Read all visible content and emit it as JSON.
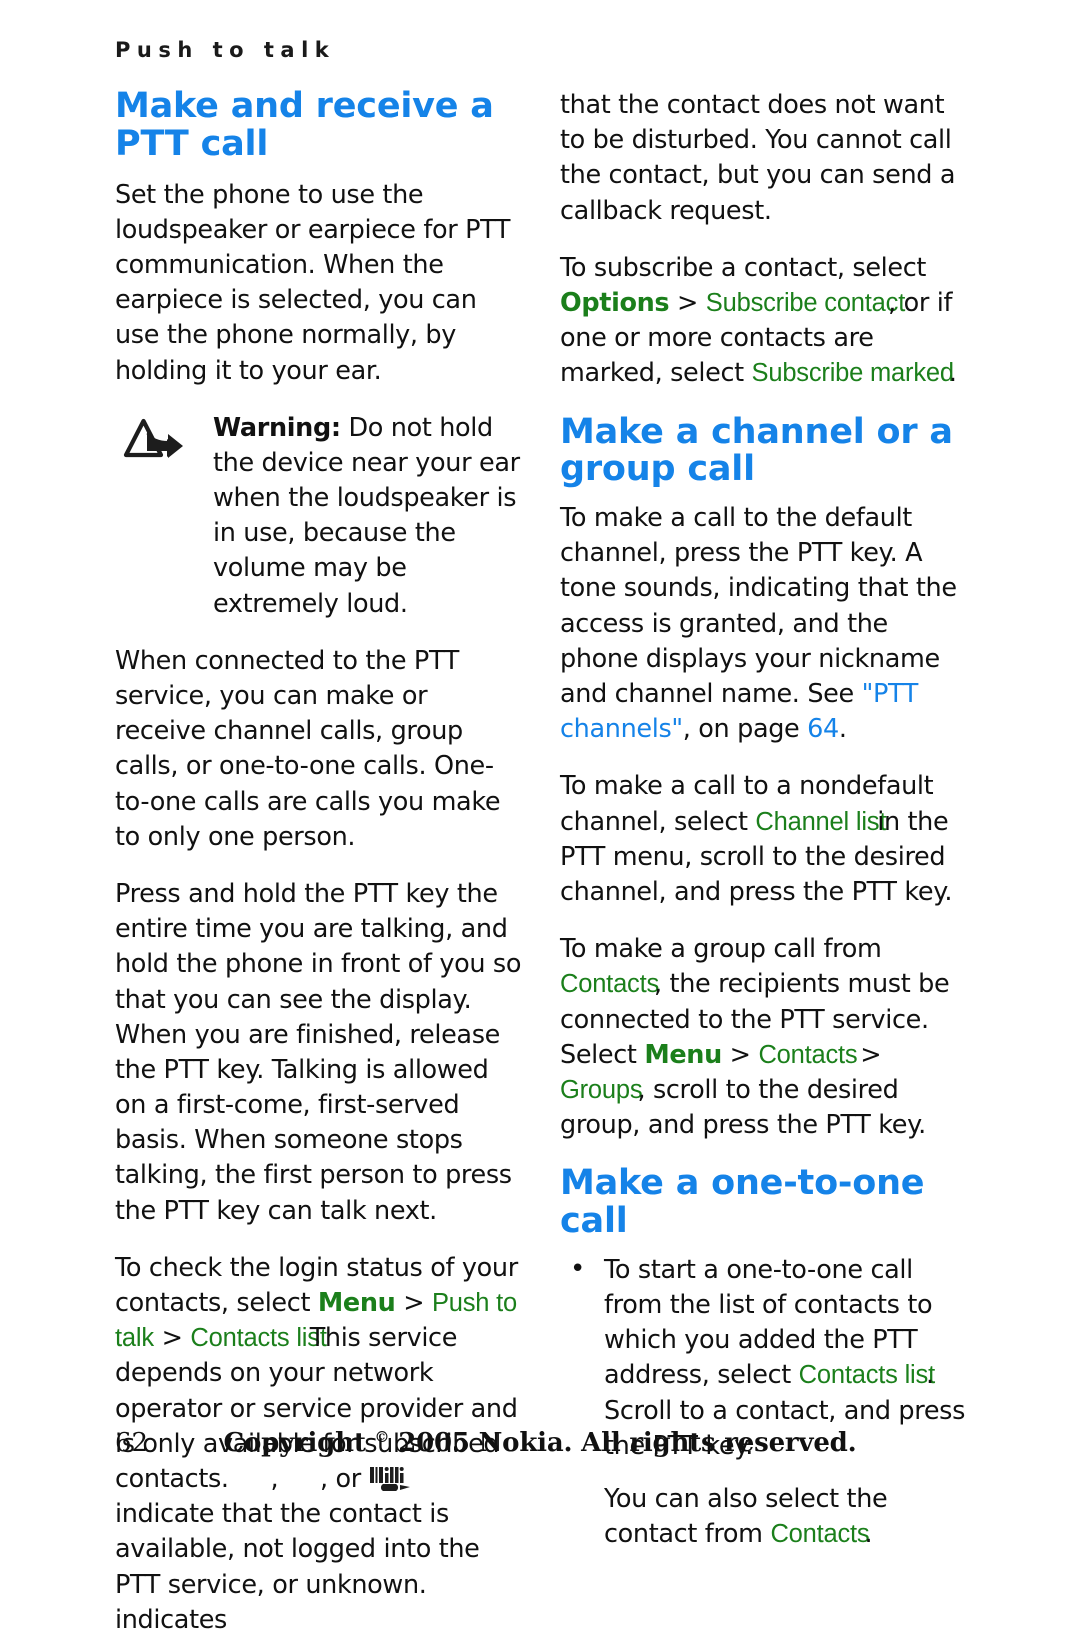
{
  "document": {
    "running_head": "Push to talk",
    "page_number": "62",
    "copyright_prefix": "Copyright",
    "copyright_symbol": "©",
    "copyright_rest": "2005 Nokia. All rights reserved."
  },
  "left_column": {
    "heading": "Make and receive a PTT call",
    "para_intro": "Set the phone to use the loudspeaker or earpiece for PTT communication. When the earpiece is selected, you can use the phone normally, by holding it to your ear.",
    "warning": {
      "icon": "warning-triangle-arrow-icon",
      "label": "Warning:",
      "text": " Do not hold the device near your ear when the loudspeaker is in use, because the volume may be extremely loud."
    },
    "para_connected": "When connected to the PTT service, you can make or receive channel calls, group calls, or one-to-one calls. One-to-one calls are calls you make to only one person.",
    "para_press_hold": "Press and hold the PTT key the entire time you are talking, and hold the phone in front of you so that you can see the display. When you are finished, release the PTT key. Talking is allowed on a first-come, first-served basis. When someone stops talking, the first person to press the PTT key can talk next.",
    "para_login_status": {
      "t1": "To check the login status of your contacts, select ",
      "menu": "Menu",
      "sep1": " > ",
      "push_to_talk": "Push to talk",
      "sep2": " > ",
      "contacts_list": "Contacts list",
      "t2": "This service depends on your network operator or service provider and is only available for subscribed contacts. ",
      "t3": ", ",
      "t4": ", or ",
      "minisd_glyph": "miniSD-logo-glyph",
      "t5": " indicate that the contact is available, not logged into the PTT service, or unknown. ",
      "t6": " indicates"
    }
  },
  "right_column": {
    "para_continued": "that the contact does not want to be disturbed. You cannot call the contact, but you can send a callback request.",
    "para_subscribe": {
      "t1": "To subscribe a contact, select ",
      "options": "Options",
      "sep1": " > ",
      "subscribe_contact": "Subscribe contact",
      "t2": ", or if one or more contacts are marked, select ",
      "subscribe_marked": "Subscribe marked",
      "t3": "."
    },
    "heading_channel_group": "Make a channel or a group call",
    "para_default_channel": {
      "t1": "To make a call to the default channel, press the PTT key. A tone sounds, indicating that the access is granted, and the phone displays your nickname and channel name. See ",
      "xref": "\"PTT channels\"",
      "t2": ", on page ",
      "page_ref": "64",
      "t3": "."
    },
    "para_nondefault_channel": {
      "t1": "To make a call to a nondefault channel, select ",
      "channel_list": "Channel list",
      "t2": "in the PTT menu, scroll to the desired channel, and press the PTT key."
    },
    "para_group_call": {
      "t1": "To make a group call from ",
      "contacts1": "Contacts",
      "t2": ", the recipients must be connected to the PTT service. Select ",
      "menu": "Menu",
      "sep1": " > ",
      "contacts2": "Contacts",
      "sep2": " > ",
      "groups": "Groups",
      "t3": ", scroll to the desired group, and press the PTT key."
    },
    "heading_one_to_one": "Make a one-to-one call",
    "bullet_one_to_one": {
      "t1": "To start a one-to-one call from the list of contacts to which you added the PTT address, select ",
      "contacts_list": "Contacts list",
      "t2": ". Scroll to a contact, and press the PTT key."
    },
    "para_also_select": {
      "t1": "You can also select the contact from ",
      "contacts": "Contacts",
      "t2": "."
    }
  },
  "colors": {
    "heading_blue": "#1583e8",
    "ui_green": "#1b7f1b",
    "xref_blue": "#1583e8",
    "body_black": "#111111",
    "page_background": "#ffffff"
  }
}
